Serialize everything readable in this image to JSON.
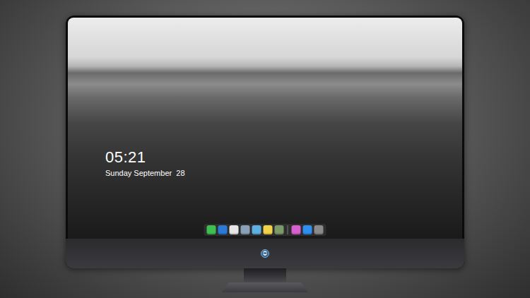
{
  "lock_screen": {
    "time": "05:21",
    "date": "Sunday September  28"
  },
  "dock": {
    "items": [
      {
        "kind": "app",
        "color": "#3fbf4f"
      },
      {
        "kind": "app",
        "color": "#2a7ad6"
      },
      {
        "kind": "app",
        "color": "#e6e6e6"
      },
      {
        "kind": "app",
        "color": "#8aa0b8"
      },
      {
        "kind": "app",
        "color": "#5fb0e0"
      },
      {
        "kind": "app",
        "color": "#f2d24a"
      },
      {
        "kind": "app",
        "color": "#7a9a6a"
      },
      {
        "kind": "separator"
      },
      {
        "kind": "app",
        "color": "#d85fd0"
      },
      {
        "kind": "app",
        "color": "#2f8ff0"
      },
      {
        "kind": "app",
        "color": "#8a8a8a"
      }
    ]
  }
}
